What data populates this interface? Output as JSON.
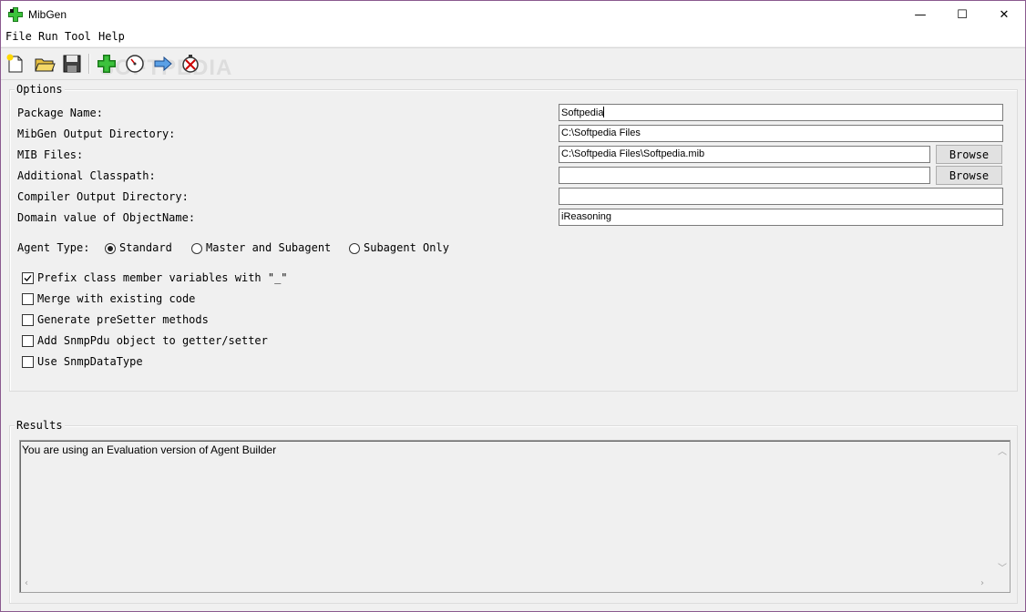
{
  "window": {
    "title": "MibGen",
    "minimize_glyph": "—",
    "maximize_glyph": "☐",
    "close_glyph": "✕"
  },
  "menu": {
    "items": [
      "File",
      "Run",
      "Tool",
      "Help"
    ]
  },
  "toolbar": {
    "icons": [
      "new-file-icon",
      "open-folder-icon",
      "save-icon",
      "add-module-icon",
      "gauge-icon",
      "arrow-right-icon",
      "stop-clock-icon"
    ],
    "watermark": "SOFTPEDIA"
  },
  "options": {
    "title": "Options",
    "package_name": {
      "label": "Package Name:",
      "value": "Softpedia"
    },
    "output_dir": {
      "label": "MibGen Output Directory:",
      "value": "C:\\Softpedia Files"
    },
    "mib_files": {
      "label": "MIB Files:",
      "value": "C:\\Softpedia Files\\Softpedia.mib",
      "button": "Browse"
    },
    "classpath": {
      "label": "Additional Classpath:",
      "value": "",
      "button": "Browse"
    },
    "compiler_dir": {
      "label": "Compiler Output Directory:",
      "value": ""
    },
    "domain_value": {
      "label": "Domain value of ObjectName:",
      "value": "iReasoning"
    },
    "agent_type": {
      "label": "Agent Type:",
      "options": [
        "Standard",
        "Master and Subagent",
        "Subagent Only"
      ],
      "selected": "Standard"
    },
    "checkboxes": [
      {
        "label": "Prefix class member variables with \"_\"",
        "checked": true
      },
      {
        "label": "Merge with existing code",
        "checked": false
      },
      {
        "label": "Generate preSetter methods",
        "checked": false
      },
      {
        "label": "Add SnmpPdu object to getter/setter",
        "checked": false
      },
      {
        "label": "Use SnmpDataType",
        "checked": false
      }
    ]
  },
  "results": {
    "title": "Results",
    "text": "You are using an Evaluation version of Agent Builder"
  },
  "colors": {
    "window_border": "#8a5a8f",
    "background": "#f0f0f0"
  }
}
